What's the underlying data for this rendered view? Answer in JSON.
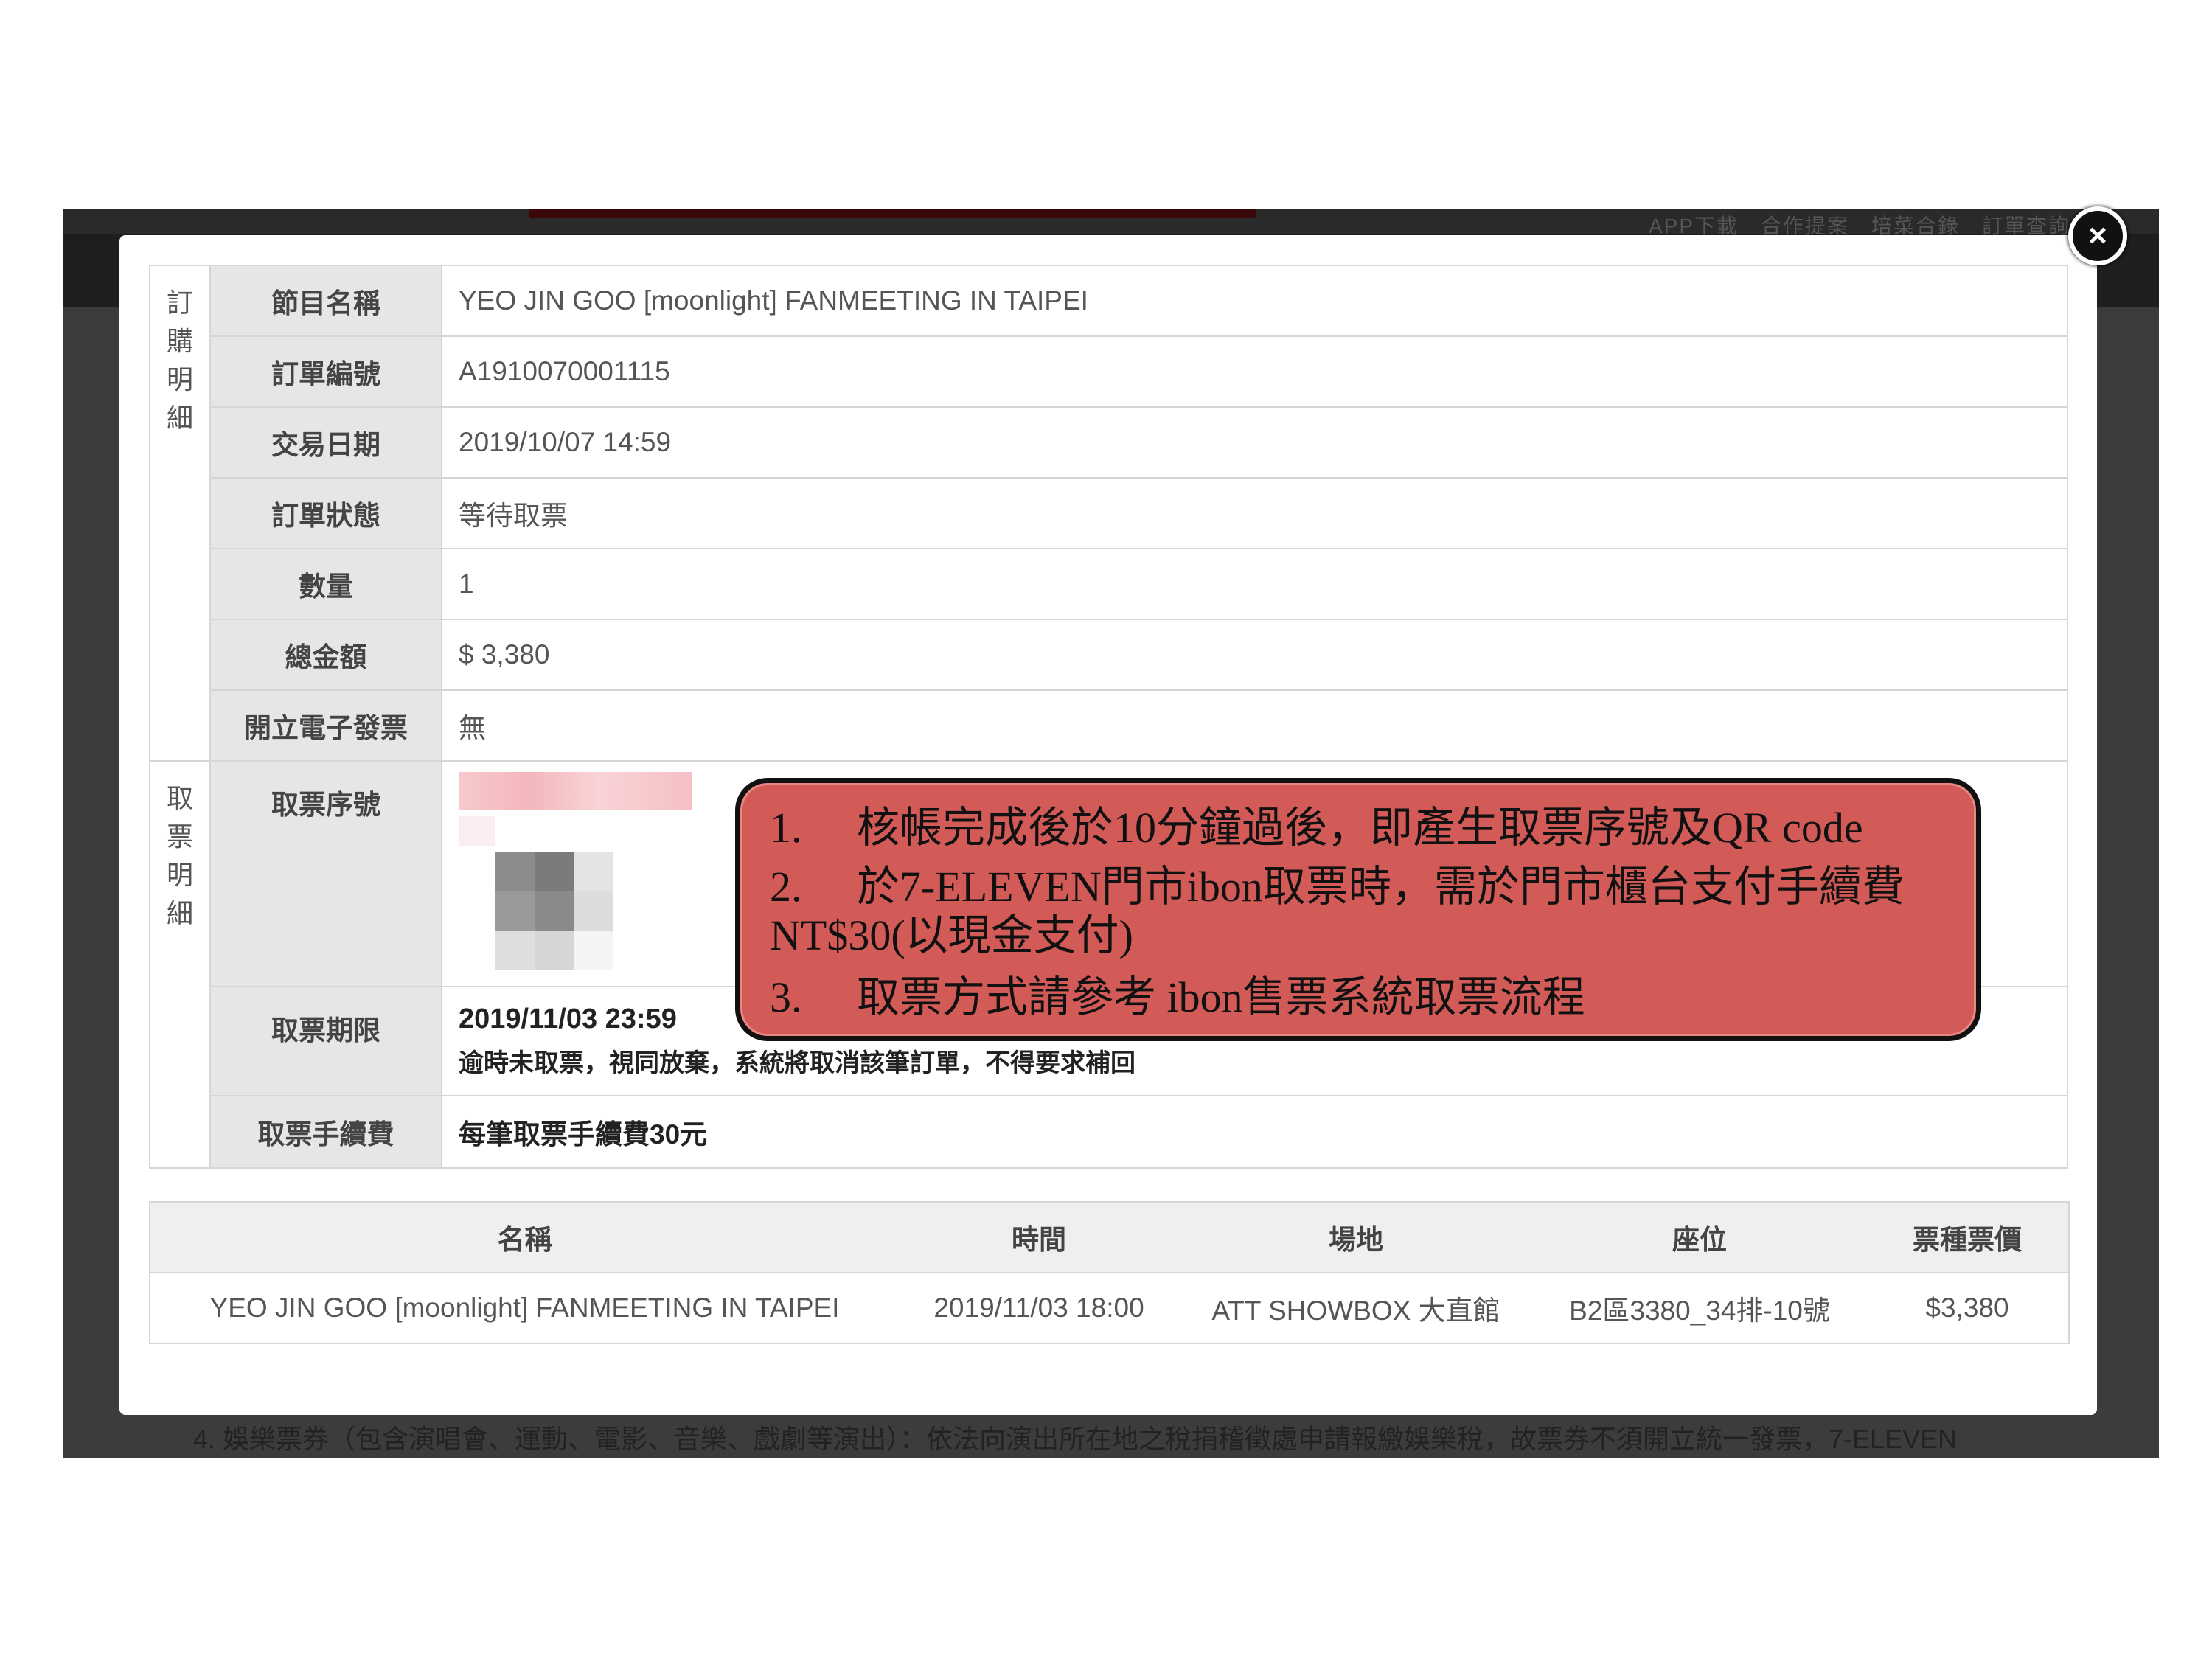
{
  "background_page": {
    "top_nav_text": "APP下載　合作提案　培菜合錄　訂單查詢",
    "bottom_text": "4. 娛樂票券（包含演唱會、運動、電影、音樂、戲劇等演出）：依法向演出所在地之稅捐稽徵處申請報繳娛樂稅，故票券不須開立統一發票，7-ELEVEN"
  },
  "modal": {
    "close_icon": "×",
    "order_section_title": "訂\n購\n明\n細",
    "pickup_section_title": "取\n票\n明\n細",
    "order": {
      "program_name_label": "節目名稱",
      "program_name": "YEO JIN GOO [moonlight] FANMEETING IN TAIPEI",
      "order_no_label": "訂單編號",
      "order_no": "A1910070001115",
      "trade_date_label": "交易日期",
      "trade_date": "2019/10/07 14:59",
      "status_label": "訂單狀態",
      "status": "等待取票",
      "quantity_label": "數量",
      "quantity": "1",
      "total_label": "總金額",
      "total": "$ 3,380",
      "invoice_label": "開立電子發票",
      "invoice": "無"
    },
    "pickup": {
      "serial_label": "取票序號",
      "deadline_label": "取票期限",
      "deadline": "2019/11/03 23:59",
      "deadline_note": "逾時未取票，視同放棄，系統將取消該筆訂單，不得要求補回",
      "fee_label": "取票手續費",
      "fee": "每筆取票手續費30元"
    },
    "tickets": {
      "headers": [
        "名稱",
        "時間",
        "場地",
        "座位",
        "票種票價"
      ],
      "rows": [
        [
          "YEO JIN GOO [moonlight] FANMEETING IN TAIPEI",
          "2019/11/03 18:00",
          "ATT SHOWBOX 大直館",
          "B2區3380_34排-10號",
          "$3,380"
        ]
      ]
    }
  },
  "callout": {
    "items": [
      {
        "num": "1.",
        "text": "核帳完成後於10分鐘過後，即產生取票序號及QR code"
      },
      {
        "num": "2.",
        "text": "於7-ELEVEN門市ibon取票時，需於門市櫃台支付手續費NT$30(以現金支付)"
      },
      {
        "num": "3.",
        "text": "取票方式請參考 ibon售票系統取票流程"
      }
    ]
  }
}
